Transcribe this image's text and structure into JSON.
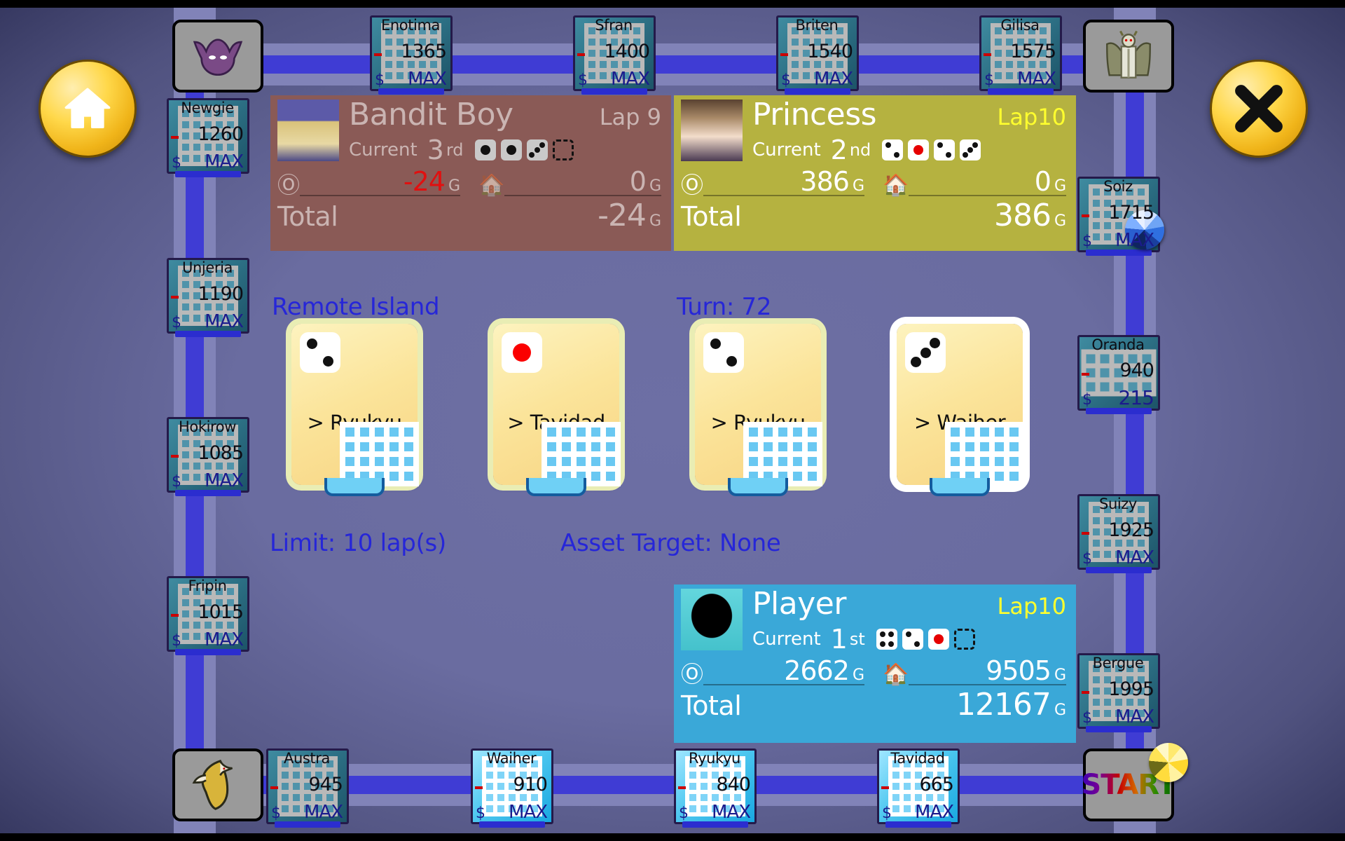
{
  "buttons": {
    "home_label": "home-button",
    "close_label": "close-button",
    "start_label": "START"
  },
  "status": {
    "location": "Remote Island",
    "turn": "Turn: 72",
    "limit": "Limit: 10 lap(s)",
    "asset_target": "Asset Target: None"
  },
  "players": [
    {
      "name": "Bandit Boy",
      "lap": "Lap 9",
      "current_label": "Current",
      "rank": "3",
      "rank_suffix": "rd",
      "cash": "-24",
      "cash_suffix": "G",
      "assets": "0",
      "assets_suffix": "G",
      "total_label": "Total",
      "total": "-24",
      "total_suffix": "G",
      "dice": [
        "1r",
        "1r",
        "3",
        "empty"
      ],
      "color": "#8a5a56",
      "active": false
    },
    {
      "name": "Princess",
      "lap": "Lap10",
      "current_label": "Current",
      "rank": "2",
      "rank_suffix": "nd",
      "cash": "386",
      "cash_suffix": "G",
      "assets": "0",
      "assets_suffix": "G",
      "total_label": "Total",
      "total": "386",
      "total_suffix": "G",
      "dice": [
        "2",
        "1r",
        "2",
        "3"
      ],
      "color": "#b5b240",
      "active": true
    },
    {
      "name": "Player",
      "lap": "Lap10",
      "current_label": "Current",
      "rank": "1",
      "rank_suffix": "st",
      "cash": "2662",
      "cash_suffix": "G",
      "assets": "9505",
      "assets_suffix": "G",
      "total_label": "Total",
      "total": "12167",
      "total_suffix": "G",
      "dice": [
        "4",
        "2",
        "1r",
        "empty"
      ],
      "color": "#3aa8d8",
      "active": true
    }
  ],
  "cards": [
    {
      "die": "2",
      "label": "> Ryukyu",
      "selected": false
    },
    {
      "die": "1r",
      "label": "> Tavidad",
      "selected": false
    },
    {
      "die": "2",
      "label": "> Ryukyu",
      "selected": false
    },
    {
      "die": "3",
      "label": "> Waiher",
      "selected": true
    }
  ],
  "tiles": {
    "top": [
      {
        "name": "Enotima",
        "price": "1365",
        "dollar": "$",
        "value": "MAX",
        "style": "teal"
      },
      {
        "name": "Sfran",
        "price": "1400",
        "dollar": "$",
        "value": "MAX",
        "style": "teal"
      },
      {
        "name": "Briten",
        "price": "1540",
        "dollar": "$",
        "value": "MAX",
        "style": "teal"
      },
      {
        "name": "Gilisa",
        "price": "1575",
        "dollar": "$",
        "value": "MAX",
        "style": "teal"
      }
    ],
    "left": [
      {
        "name": "Newgie",
        "price": "1260",
        "dollar": "$",
        "value": "MAX",
        "style": "teal"
      },
      {
        "name": "Unjeria",
        "price": "1190",
        "dollar": "$",
        "value": "MAX",
        "style": "teal"
      },
      {
        "name": "Hokirow",
        "price": "1085",
        "dollar": "$",
        "value": "MAX",
        "style": "teal"
      },
      {
        "name": "Fripin",
        "price": "1015",
        "dollar": "$",
        "value": "MAX",
        "style": "teal"
      }
    ],
    "right": [
      {
        "name": "Soiz",
        "price": "1715",
        "dollar": "$",
        "value": "MAX",
        "style": "teal",
        "token": "blue"
      },
      {
        "name": "Oranda",
        "price": "940",
        "dollar": "$",
        "value": "215",
        "style": "teal"
      },
      {
        "name": "Suizy",
        "price": "1925",
        "dollar": "$",
        "value": "MAX",
        "style": "teal"
      },
      {
        "name": "Bergue",
        "price": "1995",
        "dollar": "$",
        "value": "MAX",
        "style": "teal"
      }
    ],
    "bottom": [
      {
        "name": "Austra",
        "price": "945",
        "dollar": "$",
        "value": "MAX",
        "style": "teal"
      },
      {
        "name": "Waiher",
        "price": "910",
        "dollar": "$",
        "value": "MAX",
        "style": "cyan"
      },
      {
        "name": "Ryukyu",
        "price": "840",
        "dollar": "$",
        "value": "MAX",
        "style": "cyan"
      },
      {
        "name": "Tavidad",
        "price": "665",
        "dollar": "$",
        "value": "MAX",
        "style": "cyan"
      }
    ]
  },
  "avatars": {
    "top_left": "bat-monster-icon",
    "top_right": "angel-monster-icon",
    "bottom_left": "bird-monster-icon"
  }
}
